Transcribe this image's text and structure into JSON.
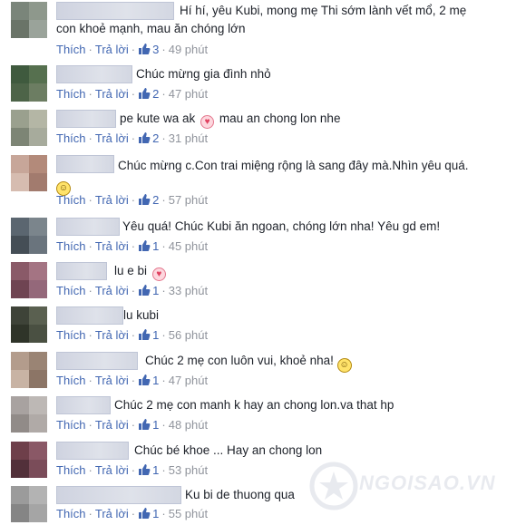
{
  "comments": [
    {
      "text": "Hí hí, yêu Kubi, mong mẹ Thi sớm lành vết mổ, 2 mẹ",
      "text2": "con khoẻ mạnh, mau ăn chóng lớn",
      "like_label": "Thích",
      "reply_label": "Trả lời",
      "likes": "3",
      "time": "49 phút"
    },
    {
      "text": "Chúc mừng gia đình nhỏ",
      "like_label": "Thích",
      "reply_label": "Trả lời",
      "likes": "2",
      "time": "47 phút"
    },
    {
      "text": "pe kute wa ak",
      "text_after": "mau an chong lon nhe",
      "like_label": "Thích",
      "reply_label": "Trả lời",
      "likes": "2",
      "time": "31 phút"
    },
    {
      "text": "Chúc mừng c.Con trai miệng rộng là sang đây mà.Nhìn yêu quá.",
      "like_label": "Thích",
      "reply_label": "Trả lời",
      "likes": "2",
      "time": "57 phút"
    },
    {
      "text": "Yêu quá! Chúc Kubi ăn ngoan, chóng lớn nha! Yêu gd em!",
      "like_label": "Thích",
      "reply_label": "Trả lời",
      "likes": "1",
      "time": "45 phút"
    },
    {
      "text": "lu e bi",
      "like_label": "Thích",
      "reply_label": "Trả lời",
      "likes": "1",
      "time": "33 phút"
    },
    {
      "text": "lu kubi",
      "like_label": "Thích",
      "reply_label": "Trả lời",
      "likes": "1",
      "time": "56 phút"
    },
    {
      "text": "Chúc 2 mẹ con luôn vui, khoẻ nha!",
      "like_label": "Thích",
      "reply_label": "Trả lời",
      "likes": "1",
      "time": "47 phút"
    },
    {
      "text": "Chúc 2 mẹ con manh k hay an chong lon.va that hp",
      "like_label": "Thích",
      "reply_label": "Trả lời",
      "likes": "1",
      "time": "48 phút"
    },
    {
      "text": "Chúc bé khoe ... Hay an chong lon",
      "like_label": "Thích",
      "reply_label": "Trả lời",
      "likes": "1",
      "time": "53 phút"
    },
    {
      "text": "Ku bi de thuong qua",
      "like_label": "Thích",
      "reply_label": "Trả lời",
      "likes": "1",
      "time": "55 phút"
    }
  ],
  "icons": {
    "like": "thumbs-up-icon",
    "heart": "heart-emoji-icon",
    "smile": "smile-emoji-icon",
    "grin": "grin-emoji-icon"
  },
  "colors": {
    "link": "#4267b2",
    "meta": "#90949c",
    "text": "#1d2129"
  },
  "watermark": {
    "text": "NGOISAO.VN"
  }
}
